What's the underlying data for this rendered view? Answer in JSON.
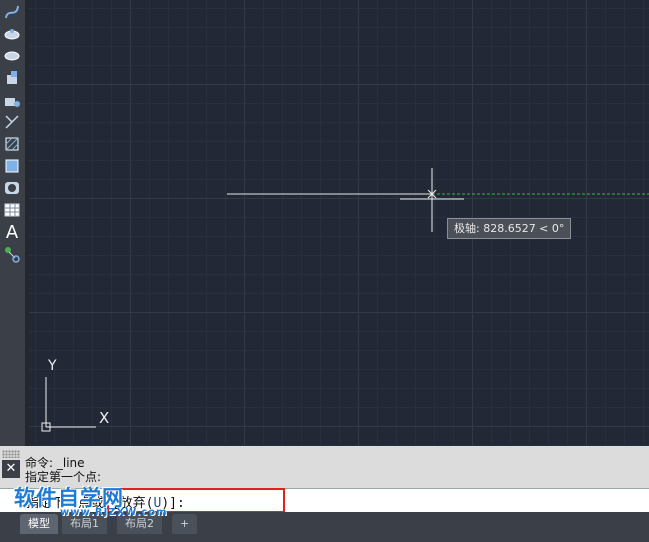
{
  "toolbar": {
    "tools": [
      {
        "icon": "spline-icon"
      },
      {
        "icon": "ellipse-icon"
      },
      {
        "icon": "ellipse-arc-icon"
      },
      {
        "icon": "insert-block-icon"
      },
      {
        "icon": "make-block-icon"
      },
      {
        "icon": "point-icon"
      },
      {
        "icon": "hatch-icon"
      },
      {
        "icon": "gradient-icon"
      },
      {
        "icon": "region-icon"
      },
      {
        "icon": "table-icon"
      },
      {
        "icon": "multiline-text-icon",
        "glyph": "A"
      },
      {
        "icon": "add-selected-icon"
      }
    ]
  },
  "canvas": {
    "tooltip": "极轴: 828.6527 < 0°",
    "ucs": {
      "x_label": "X",
      "y_label": "Y"
    }
  },
  "command": {
    "close_glyph": "✕",
    "history": [
      "命令: _line",
      "指定第一个点:"
    ],
    "prompt_prefix": "指定下一点或 [放弃(",
    "prompt_key": "U",
    "prompt_suffix": ")]:"
  },
  "tabs": [
    "模型",
    "布局1",
    "布局2",
    "+"
  ],
  "watermark": {
    "title": "软件自学网",
    "url": "www.RJZXW.com"
  }
}
